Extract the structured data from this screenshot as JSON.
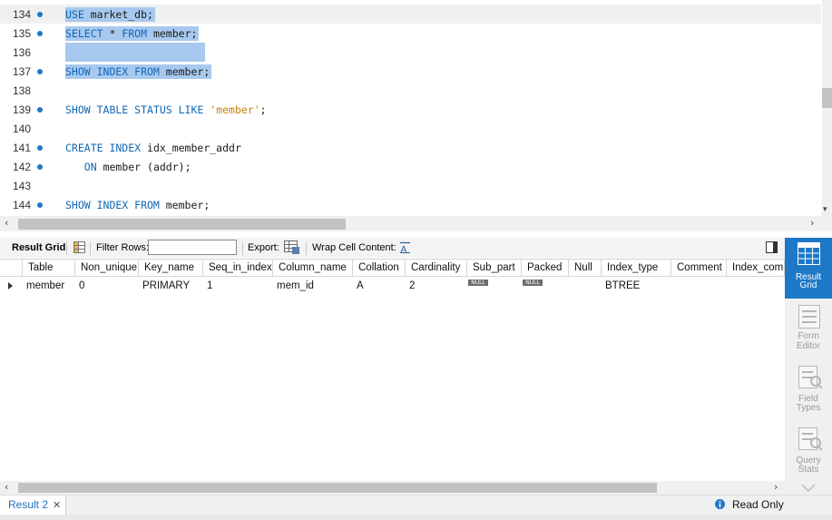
{
  "editor": {
    "lines": [
      {
        "num": "134",
        "tokens": [
          [
            "kw",
            "USE"
          ],
          [
            "tx",
            " market_db;"
          ]
        ],
        "selected": true,
        "current": true
      },
      {
        "num": "135",
        "tokens": [
          [
            "kw",
            "SELECT"
          ],
          [
            "tx",
            " * "
          ],
          [
            "kw",
            "FROM"
          ],
          [
            "tx",
            " member;"
          ]
        ],
        "selected": true
      },
      {
        "num": "136",
        "tokens": [],
        "selected": true
      },
      {
        "num": "137",
        "tokens": [
          [
            "kw",
            "SHOW INDEX FROM"
          ],
          [
            "tx",
            " member;"
          ]
        ],
        "selected": true
      },
      {
        "num": "138",
        "tokens": []
      },
      {
        "num": "139",
        "tokens": [
          [
            "kw",
            "SHOW TABLE STATUS LIKE"
          ],
          [
            "tx",
            " "
          ],
          [
            "st",
            "'member'"
          ],
          [
            "tx",
            ";"
          ]
        ]
      },
      {
        "num": "141",
        "tokens": [
          [
            "kw",
            "CREATE INDEX"
          ],
          [
            "tx",
            " idx_member_addr"
          ]
        ]
      },
      {
        "num": "142",
        "tokens": [
          [
            "tx",
            "   "
          ],
          [
            "kw",
            "ON"
          ],
          [
            "tx",
            " member (addr);"
          ]
        ]
      },
      {
        "num": "143",
        "tokens": []
      },
      {
        "num": "144",
        "tokens": [
          [
            "kw",
            "SHOW INDEX FROM"
          ],
          [
            "tx",
            " member;"
          ]
        ]
      }
    ],
    "line140": "140"
  },
  "toolbar": {
    "result_grid_label": "Result Grid",
    "filter_rows_label": "Filter Rows:",
    "filter_value": "",
    "export_label": "Export:",
    "wrap_label": "Wrap Cell Content:"
  },
  "grid": {
    "columns": [
      "Table",
      "Non_unique",
      "Key_name",
      "Seq_in_index",
      "Column_name",
      "Collation",
      "Cardinality",
      "Sub_part",
      "Packed",
      "Null",
      "Index_type",
      "Comment",
      "Index_comm"
    ],
    "rows": [
      [
        "member",
        "0",
        "PRIMARY",
        "1",
        "mem_id",
        "A",
        "2",
        "NULL",
        "NULL",
        "",
        "BTREE",
        "",
        ""
      ]
    ]
  },
  "side_panel": {
    "result_grid": [
      "Result",
      "Grid"
    ],
    "form_editor": [
      "Form",
      "Editor"
    ],
    "field_types": [
      "Field",
      "Types"
    ],
    "query_stats": [
      "Query",
      "Stats"
    ]
  },
  "status": {
    "tab_label": "Result 2",
    "read_only": "Read Only"
  },
  "colors": {
    "accent": "#1e78c8",
    "selection": "#a8c9ef",
    "keyword": "#1066b4",
    "string": "#c57f10"
  }
}
